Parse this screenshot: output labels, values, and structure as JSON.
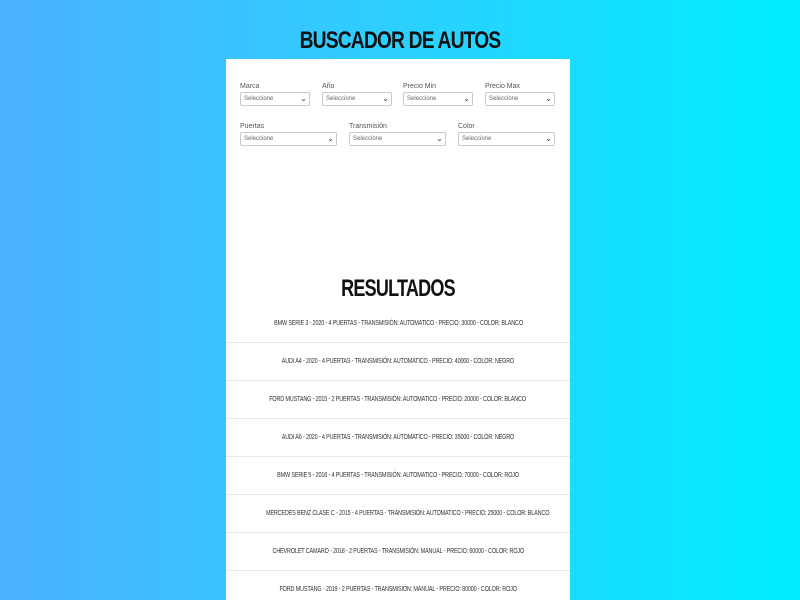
{
  "page": {
    "title": "BUSCADOR DE AUTOS"
  },
  "filters": {
    "marca": {
      "label": "Marca",
      "value": "Seleccione"
    },
    "anio": {
      "label": "Año",
      "value": "Seleccione"
    },
    "precio_min": {
      "label": "Precio Min",
      "value": "Seleccione"
    },
    "precio_max": {
      "label": "Precio Max",
      "value": "Seleccione"
    },
    "puertas": {
      "label": "Puertas",
      "value": "Seleccione"
    },
    "transmision": {
      "label": "Transmisión",
      "value": "Seleccione"
    },
    "color": {
      "label": "Color",
      "value": "Seleccione"
    }
  },
  "results": {
    "title": "RESULTADOS",
    "items": [
      "BMW Serie 3 - 2020 - 4 Puertas - Transmisión: Automatico - Precio: 30000 - Color: Blanco",
      "Audi A4 - 2020 - 4 Puertas - Transmisión: Automatico - Precio: 40000 - Color: Negro",
      "Ford Mustang - 2015 - 2 Puertas - Transmisión: Automatico - Precio: 20000 - Color: Blanco",
      "Audi A6 - 2020 - 4 Puertas - Transmisión: Automatico - Precio: 35000 - Color: Negro",
      "BMW Serie 5 - 2016 - 4 Puertas - Transmisión: Automatico - Precio: 70000 - Color: Rojo",
      "Mercedes Benz Clase C - 2015 - 4 Puertas - Transmisión: Automatico - Precio: 25000 - Color: Blanco",
      "Chevrolet Camaro - 2018 - 2 Puertas - Transmisión: Manual - Precio: 60000 - Color: Rojo",
      "Ford Mustang - 2019 - 2 Puertas - Transmisión: Manual - Precio: 80000 - Color: Rojo"
    ]
  },
  "colors": {
    "gradient_left": "#4ab0ff",
    "gradient_right": "#00eeff",
    "card_background": "#ffffff"
  },
  "icons": {
    "select_arrow": "chevron-down-icon"
  }
}
